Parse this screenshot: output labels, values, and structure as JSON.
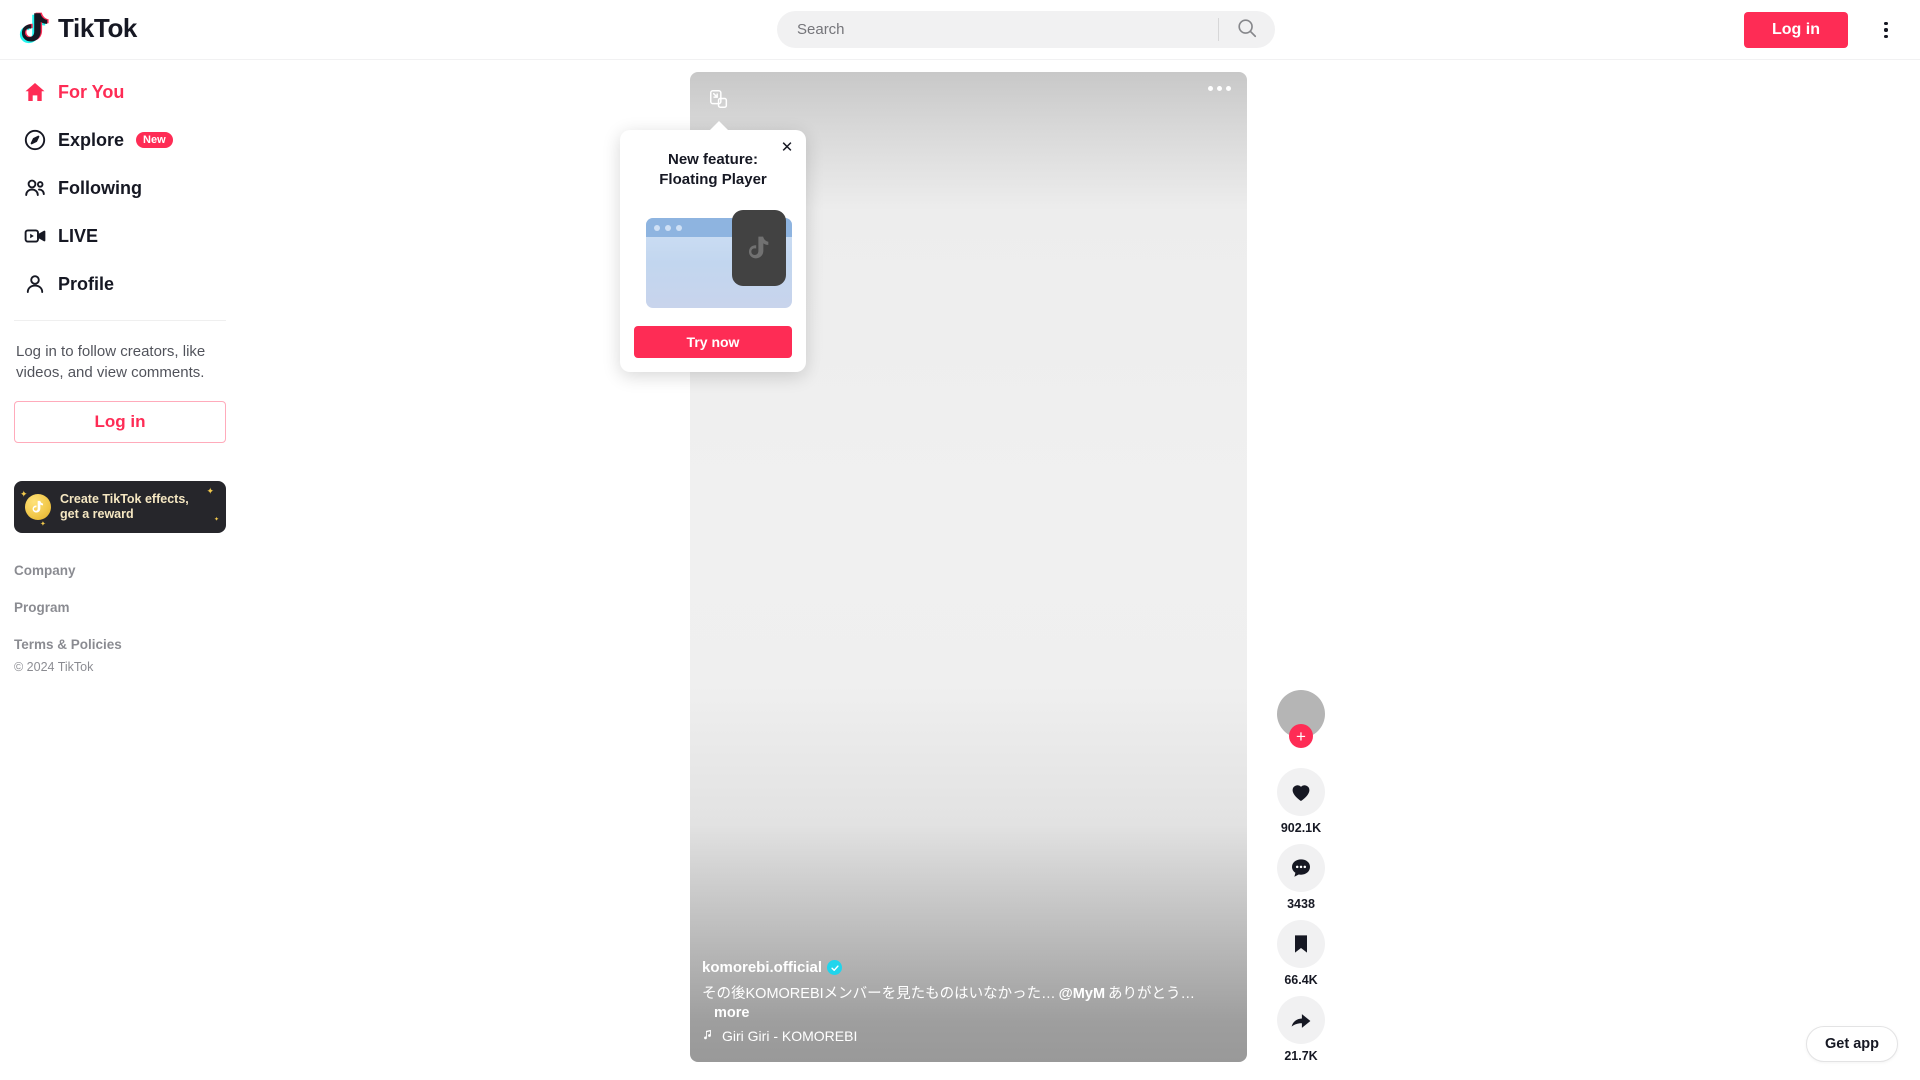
{
  "header": {
    "logo_text": "TikTok",
    "search": {
      "placeholder": "Search",
      "value": ""
    },
    "login_label": "Log in"
  },
  "sidebar": {
    "items": [
      {
        "label": "For You",
        "icon": "home-icon",
        "active": true,
        "badge": ""
      },
      {
        "label": "Explore",
        "icon": "compass-icon",
        "active": false,
        "badge": "New"
      },
      {
        "label": "Following",
        "icon": "people-icon",
        "active": false,
        "badge": ""
      },
      {
        "label": "LIVE",
        "icon": "live-video-icon",
        "active": false,
        "badge": ""
      },
      {
        "label": "Profile",
        "icon": "person-icon",
        "active": false,
        "badge": ""
      }
    ],
    "login_prompt": "Log in to follow creators, like videos, and view comments.",
    "login_label": "Log in",
    "promo": {
      "line1": "Create TikTok effects,",
      "line2": "get a reward"
    },
    "footer_links": [
      "Company",
      "Program",
      "Terms & Policies"
    ],
    "copyright": "© 2024 TikTok"
  },
  "video": {
    "author": "komorebi.official",
    "verified": true,
    "caption": "その後KOMOREBIメンバーを見たものはいなかった…",
    "mention": "@MyM",
    "caption_tail": "ありがとう…",
    "more_label": "more",
    "music": "Giri Giri - KOMOREBI",
    "music_icon": "music-note-icon",
    "pip_icon": "floating-player-icon",
    "menu_icon": "more-options-icon"
  },
  "actions": {
    "follow_label": "+",
    "items": [
      {
        "name": "like",
        "icon": "heart-icon",
        "count": "902.1K"
      },
      {
        "name": "comment",
        "icon": "comment-icon",
        "count": "3438"
      },
      {
        "name": "bookmark",
        "icon": "bookmark-icon",
        "count": "66.4K"
      },
      {
        "name": "share",
        "icon": "share-arrow-icon",
        "count": "21.7K"
      }
    ]
  },
  "popup": {
    "title_line1": "New feature:",
    "title_line2": "Floating Player",
    "cta_label": "Try now",
    "close_label": "✕"
  },
  "get_app": {
    "label": "Get app"
  },
  "colors": {
    "brand_pink": "#fe2c55",
    "brand_cyan": "#25f4ee",
    "verified_blue": "#20d5ec",
    "text_primary": "#161823",
    "promo_bg": "#26262b",
    "promo_gold": "#f2c94c"
  }
}
